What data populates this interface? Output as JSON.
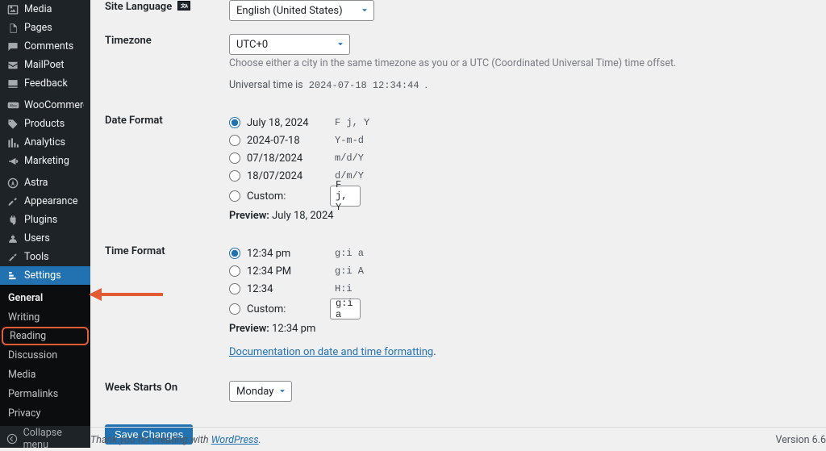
{
  "sidebar": {
    "items": [
      {
        "label": "Media"
      },
      {
        "label": "Pages"
      },
      {
        "label": "Comments"
      },
      {
        "label": "MailPoet"
      },
      {
        "label": "Feedback"
      },
      {
        "label": "WooCommerce"
      },
      {
        "label": "Products"
      },
      {
        "label": "Analytics"
      },
      {
        "label": "Marketing"
      },
      {
        "label": "Astra"
      },
      {
        "label": "Appearance"
      },
      {
        "label": "Plugins"
      },
      {
        "label": "Users"
      },
      {
        "label": "Tools"
      },
      {
        "label": "Settings"
      }
    ],
    "submenu": [
      {
        "label": "General"
      },
      {
        "label": "Writing"
      },
      {
        "label": "Reading"
      },
      {
        "label": "Discussion"
      },
      {
        "label": "Media"
      },
      {
        "label": "Permalinks"
      },
      {
        "label": "Privacy"
      }
    ],
    "collapse_label": "Collapse menu"
  },
  "form": {
    "site_language": {
      "label": "Site Language",
      "value": "English (United States)"
    },
    "timezone": {
      "label": "Timezone",
      "value": "UTC+0",
      "help": "Choose either a city in the same timezone as you or a UTC (Coordinated Universal Time) time offset.",
      "ut_prefix": "Universal time is ",
      "ut_value": "2024-07-18 12:34:44"
    },
    "date_format": {
      "label": "Date Format",
      "options": [
        {
          "display": "July 18, 2024",
          "code": "F j, Y",
          "checked": true
        },
        {
          "display": "2024-07-18",
          "code": "Y-m-d",
          "checked": false
        },
        {
          "display": "07/18/2024",
          "code": "m/d/Y",
          "checked": false
        },
        {
          "display": "18/07/2024",
          "code": "d/m/Y",
          "checked": false
        }
      ],
      "custom_label": "Custom:",
      "custom_value": "F j, Y",
      "preview_label": "Preview:",
      "preview_value": "July 18, 2024"
    },
    "time_format": {
      "label": "Time Format",
      "options": [
        {
          "display": "12:34 pm",
          "code": "g:i a",
          "checked": true
        },
        {
          "display": "12:34 PM",
          "code": "g:i A",
          "checked": false
        },
        {
          "display": "12:34",
          "code": "H:i",
          "checked": false
        }
      ],
      "custom_label": "Custom:",
      "custom_value": "g:i a",
      "preview_label": "Preview:",
      "preview_value": "12:34 pm",
      "doc_link_text": "Documentation on date and time formatting"
    },
    "week_starts": {
      "label": "Week Starts On",
      "value": "Monday"
    },
    "save_label": "Save Changes"
  },
  "footer": {
    "thank_you_prefix": "Thank you for creating with ",
    "wp_link": "WordPress",
    "version": "Version 6.6"
  }
}
